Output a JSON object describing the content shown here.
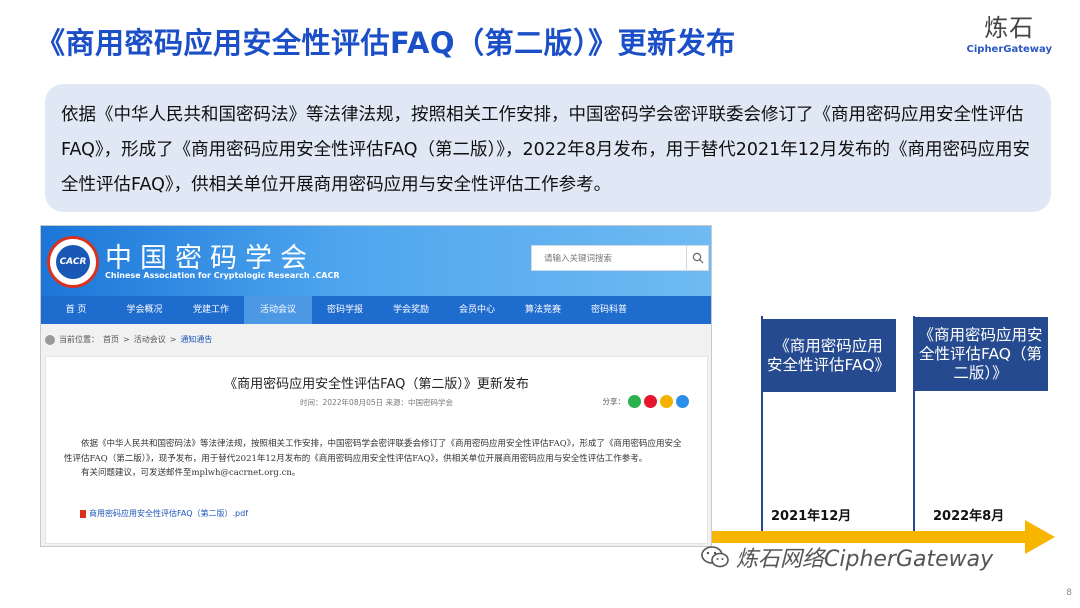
{
  "slide": {
    "title": "《商用密码应用安全性评估FAQ（第二版）》更新发布",
    "brand_cn": "炼石",
    "brand_en": "CipherGateway",
    "summary": "依据《中华人民共和国密码法》等法律法规，按照相关工作安排，中国密码学会密评联委会修订了《商用密码应用安全性评估FAQ》，形成了《商用密码应用安全性评估FAQ（第二版）》，2022年8月发布，用于替代2021年12月发布的《商用密码应用安全性评估FAQ》，供相关单位开展商用密码应用与安全性评估工作参考。",
    "page_number": "8",
    "watermark": "炼石网络CipherGateway"
  },
  "site": {
    "logo_text": "CACR",
    "name_cn": "中国密码学会",
    "name_en": "Chinese Association for Cryptologic Research .CACR",
    "search_placeholder": "请输入关键词搜索",
    "nav": [
      {
        "label": "首 页"
      },
      {
        "label": "学会概况"
      },
      {
        "label": "党建工作"
      },
      {
        "label": "活动会议"
      },
      {
        "label": "密码学报"
      },
      {
        "label": "学会奖励"
      },
      {
        "label": "会员中心"
      },
      {
        "label": "算法竞赛"
      },
      {
        "label": "密码科普"
      }
    ],
    "breadcrumb": {
      "prefix": "当前位置：",
      "home": "首页",
      "sep": ">",
      "section": "活动会议",
      "current": "通知通告"
    },
    "article": {
      "title": "《商用密码应用安全性评估FAQ（第二版）》更新发布",
      "meta": "时间：2022年08月05日   来源：中国密码学会",
      "share_label": "分享：",
      "para1": "依据《中华人民共和国密码法》等法律法规，按照相关工作安排，中国密码学会密评联委会修订了《商用密码应用安全性评估FAQ》，形成了《商用密码应用安全性评估FAQ（第二版）》，现予发布，用于替代2021年12月发布的《商用密码应用安全性评估FAQ》，供相关单位开展商用密码应用与安全性评估工作参考。",
      "para2": "有关问题建议，可发送邮件至mplwh@cacrnet.org.cn。",
      "attachment": "商用密码应用安全性评估FAQ（第二版）.pdf"
    }
  },
  "timeline": {
    "events": [
      {
        "label": "《商用密码应用安全性评估FAQ》",
        "date": "2021年12月"
      },
      {
        "label": "《商用密码应用安全性评估FAQ（第二版）》",
        "date": "2022年8月"
      }
    ],
    "card_color": "#264a8f",
    "arrow_color": "#f7b500"
  }
}
